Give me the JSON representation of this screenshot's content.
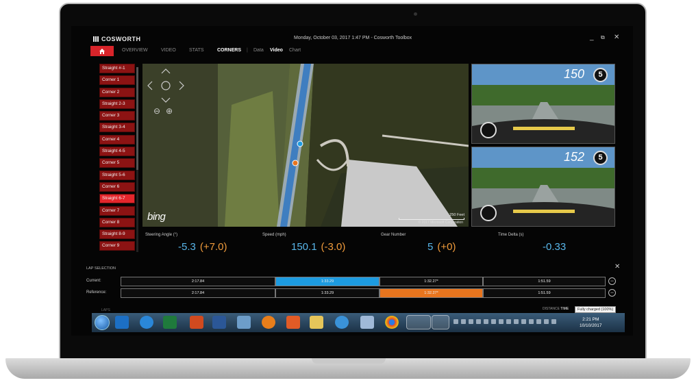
{
  "window": {
    "app_logo": "COSWORTH",
    "title": "Monday, October 03, 2017 1:47 PM - Cosworth Toolbox",
    "minimize": "_",
    "restore": "⧉",
    "close": "✕"
  },
  "nav": {
    "tabs": [
      "OVERVIEW",
      "VIDEO",
      "STATS",
      "CORNERS"
    ],
    "active_tab": "CORNERS",
    "sub_tabs": [
      "Data",
      "Video",
      "Chart"
    ],
    "active_sub_tab": "Video"
  },
  "sidebar": {
    "items": [
      "Straight #-1",
      "Corner 1",
      "Corner 2",
      "Straight 2-3",
      "Corner 3",
      "Straight 3-4",
      "Corner 4",
      "Straight 4-5",
      "Corner 5",
      "Straight 5-6",
      "Corner 6",
      "Straight 6-7",
      "Corner 7",
      "Corner 8",
      "Straight 8-9",
      "Corner 9"
    ],
    "selected": "Straight 6-7"
  },
  "map": {
    "brand": "bing",
    "scale_label": "250 Feet",
    "copyright": "© 2017 Microsoft Corporation",
    "zoom_out_icon": "⊖",
    "zoom_in_icon": "⊕"
  },
  "videos": [
    {
      "speed": "150",
      "gear": "5"
    },
    {
      "speed": "152",
      "gear": "5"
    }
  ],
  "metrics": [
    {
      "label": "Steering Angle (°)",
      "value": "-5.3",
      "delta": "(+7.0)"
    },
    {
      "label": "Speed (mph)",
      "value": "150.1",
      "delta": "(-3.0)"
    },
    {
      "label": "Gear Number",
      "value": "5",
      "delta": "(+0)"
    },
    {
      "label": "Time Delta (s)",
      "value": "-0.33",
      "delta": ""
    }
  ],
  "lap_selection": {
    "header": "LAP SELECTION",
    "close": "✕",
    "current_label": "Current:",
    "reference_label": "Reference:",
    "current": [
      "2:17.84",
      "1:33.29",
      "1:32.27*",
      "1:51.59"
    ],
    "reference": [
      "2:17.84",
      "1:33.29",
      "1:32.27*",
      "1:51.59"
    ],
    "laps_label": "LAPS",
    "distance_label": "DISTANCE",
    "time_label": "TIME",
    "battery_tooltip": "Fully charged (100%)"
  },
  "taskbar": {
    "apps": [
      "outlook",
      "internet-explorer",
      "excel",
      "powerpoint",
      "word",
      "photo-viewer",
      "ms-office",
      "media-player",
      "file-explorer",
      "quicktime",
      "notepad",
      "chrome",
      "cosworth-toolbox",
      "cosworth-app"
    ],
    "time": "2:21 PM",
    "date": "10/10/2017"
  }
}
